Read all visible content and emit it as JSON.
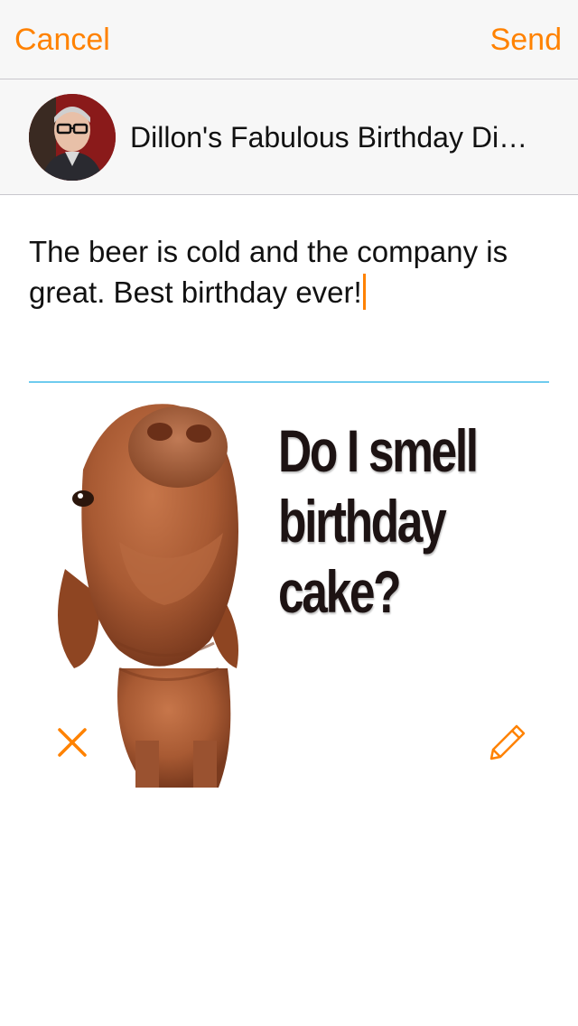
{
  "nav": {
    "cancel_label": "Cancel",
    "send_label": "Send"
  },
  "recipient": {
    "name": "Dillon's Fabulous Birthday Di…"
  },
  "message": {
    "text": "The beer is cold and the company is great. Best birthday ever!"
  },
  "attachment": {
    "caption_lines": [
      "Do I smell",
      "birthday",
      "cake?"
    ]
  },
  "icons": {
    "remove": "close-icon",
    "edit": "pencil-icon"
  },
  "colors": {
    "accent": "#ff8200",
    "divider": "#6ecbee",
    "text": "#111111"
  }
}
